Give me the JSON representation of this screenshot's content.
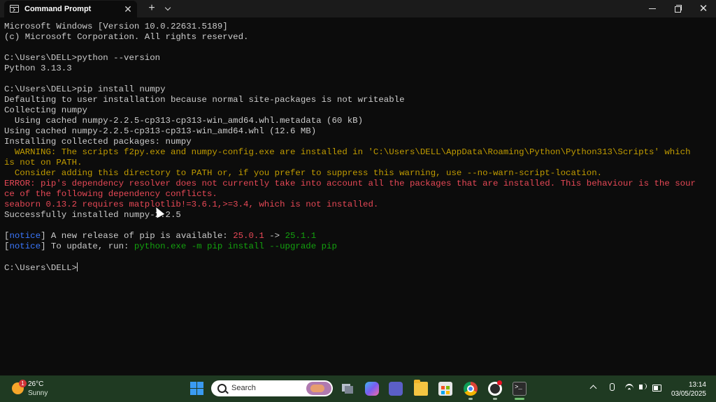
{
  "window": {
    "tab_title": "Command Prompt",
    "close_tab": "✕",
    "new_tab": "+",
    "minimize": "",
    "maximize": "",
    "close": "✕"
  },
  "console": {
    "lines": [
      "Microsoft Windows [Version 10.0.22631.5189]",
      "(c) Microsoft Corporation. All rights reserved.",
      "",
      "C:\\Users\\DELL>python --version",
      "Python 3.13.3",
      "",
      "C:\\Users\\DELL>pip install numpy",
      "Defaulting to user installation because normal site-packages is not writeable",
      "Collecting numpy",
      "  Using cached numpy-2.2.5-cp313-cp313-win_amd64.whl.metadata (60 kB)",
      "Using cached numpy-2.2.5-cp313-cp313-win_amd64.whl (12.6 MB)",
      "Installing collected packages: numpy",
      "  WARNING: The scripts f2py.exe and numpy-config.exe are installed in 'C:\\Users\\DELL\\AppData\\Roaming\\Python\\Python313\\Scripts' which",
      "is not on PATH.",
      "  Consider adding this directory to PATH or, if you prefer to suppress this warning, use --no-warn-script-location.",
      "ERROR: pip's dependency resolver does not currently take into account all the packages that are installed. This behaviour is the sour",
      "ce of the following dependency conflicts.",
      "seaborn 0.13.2 requires matplotlib!=3.6.1,>=3.4, which is not installed.",
      "Successfully installed numpy-2.2.5",
      ""
    ],
    "notice1": {
      "open": "[",
      "word": "notice",
      "close": "] A new release of pip is available: ",
      "old_version": "25.0.1",
      "arrow": " -> ",
      "new_version": "25.1.1"
    },
    "notice2": {
      "open": "[",
      "word": "notice",
      "close": "] To update, run: ",
      "command": "python.exe -m pip install --upgrade pip"
    },
    "prompt": "C:\\Users\\DELL>"
  },
  "colors": {
    "warning": "#c19c00",
    "error": "#e74856",
    "notice": "#3b78ff",
    "success": "#13a10e",
    "text": "#cccccc",
    "taskbar": "#1f3a22"
  },
  "taskbar": {
    "weather": {
      "temp": "26°C",
      "condition": "Sunny",
      "badge": "1"
    },
    "search_placeholder": "Search",
    "time": "13:14",
    "date": "03/05/2025",
    "icons": [
      "start-icon",
      "task-view-icon",
      "copilot-icon",
      "teams-icon",
      "file-explorer-icon",
      "store-icon",
      "chrome-icon",
      "obs-icon",
      "terminal-icon"
    ]
  }
}
